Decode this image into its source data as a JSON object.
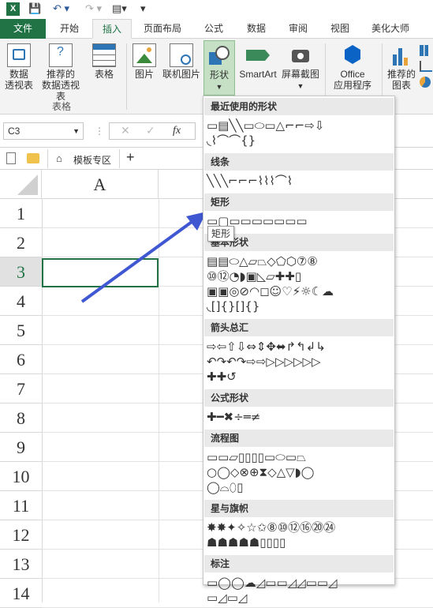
{
  "app": {
    "icon": "excel-icon"
  },
  "tabs": [
    "文件",
    "开始",
    "插入",
    "页面布局",
    "公式",
    "数据",
    "审阅",
    "视图",
    "美化大师"
  ],
  "ribbon": {
    "buttons": [
      {
        "label": "数据\n透视表"
      },
      {
        "label": "推荐的\n数据透视表"
      },
      {
        "label": "表格"
      },
      {
        "label": "图片"
      },
      {
        "label": "联机图片"
      },
      {
        "label": "形状"
      },
      {
        "label": "SmartArt"
      },
      {
        "label": "屏幕截图"
      },
      {
        "label": "Office\n应用程序"
      },
      {
        "label": "推荐的\n图表"
      }
    ],
    "group_table": "表格"
  },
  "formula": {
    "namebox": "C3",
    "fx": "fx"
  },
  "sheet": {
    "tab_label": "模板专区",
    "add": "+"
  },
  "grid": {
    "col_header": "A",
    "rows": [
      "1",
      "2",
      "3",
      "4",
      "5",
      "6",
      "7",
      "8",
      "9",
      "10",
      "11",
      "12",
      "13",
      "14"
    ],
    "selected_row": "3"
  },
  "shapes_panel": {
    "sections": [
      {
        "title": "最近使用的形状",
        "rows": [
          "▭▤╲╲▭⬭▭△⌐⌐⇨⇩",
          "◟⌇⌒⌒{}"
        ]
      },
      {
        "title": "线条",
        "rows": [
          "╲╲╲⌐⌐⌐⌇⌇⌇⌒⌇"
        ]
      },
      {
        "title": "矩形",
        "rows": [
          "▭▢▭▭▭▭▭▭▭"
        ]
      },
      {
        "title": "基本形状",
        "rows": [
          "▤▤⬭△▱⏢◇⬠⬡⑦⑧",
          "⑩⑫◔◗▣◺▱✚✚▯",
          "▣▣◎⊘◠◻☺♡⚡☼☾☁",
          "◟[]{}[]{}"
        ]
      },
      {
        "title": "箭头总汇",
        "rows": [
          "⇨⇦⇧⇩⇔⇕✥⬌↱↰↲↳",
          "↶↷↶↷⇨⇨▷▷▷▷▷▷",
          "✚✚↺"
        ]
      },
      {
        "title": "公式形状",
        "rows": [
          "✚━✖÷═≠"
        ]
      },
      {
        "title": "流程图",
        "rows": [
          "▭▭▱▯▯▯▯▭⬭▭⏢",
          "○◯◇⊗⊕⧗◇△▽◗◯",
          "◯⌓⬯▯"
        ]
      },
      {
        "title": "星与旗帜",
        "rows": [
          "✸✸✦✧☆✩⑧⑩⑫⑯⑳㉔",
          "☗☗☗☗☗▯▯▯▯"
        ]
      },
      {
        "title": "标注",
        "rows": [
          "▭◯◯☁◿▭▭◿◿▭▭◿",
          "▭◿▭◿"
        ]
      }
    ]
  },
  "tooltip": "矩形"
}
